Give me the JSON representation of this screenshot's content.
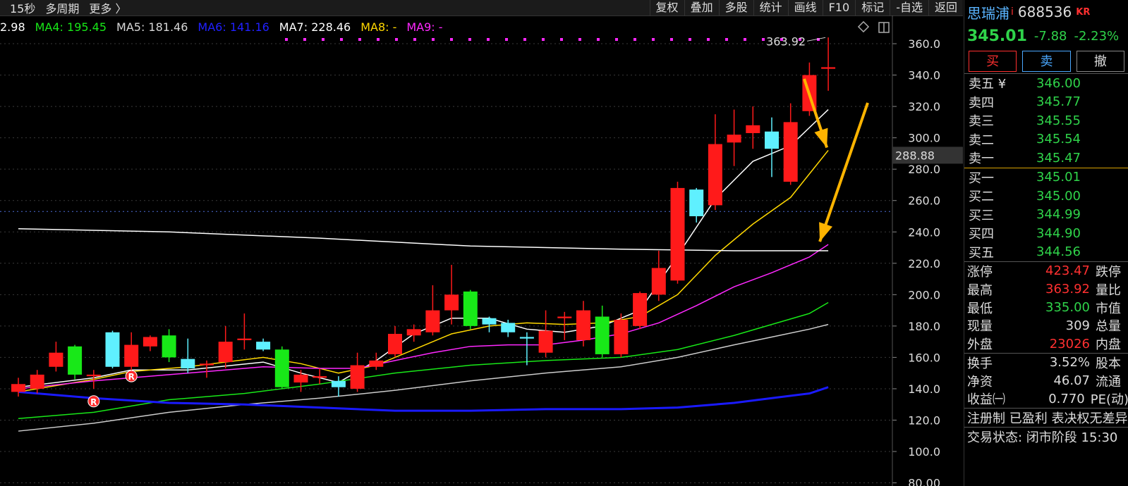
{
  "toolbar": {
    "left": [
      "15秒",
      "多周期",
      "更多 〉"
    ],
    "right": [
      "复权",
      "叠加",
      "多股",
      "统计",
      "画线",
      "F10",
      "标记",
      "-自选",
      "返回"
    ]
  },
  "ma_legend": [
    {
      "label": "2.98",
      "color": "#ffffff"
    },
    {
      "label": "MA4: 195.45",
      "color": "#18e818"
    },
    {
      "label": "MA5: 181.46",
      "color": "#d8d8d8"
    },
    {
      "label": "MA6: 141.16",
      "color": "#2020ff"
    },
    {
      "label": "MA7: 228.46",
      "color": "#ffffff"
    },
    {
      "label": "MA8: -",
      "color": "#ffd800"
    },
    {
      "label": "MA9: -",
      "color": "#ff28ff"
    }
  ],
  "chart_data": {
    "type": "candlestick",
    "y_axis_labels": [
      "360.0",
      "340.0",
      "320.0",
      "300.0",
      "280.0",
      "260.0",
      "240.0",
      "220.0",
      "200.0",
      "180.0",
      "160.0",
      "140.0",
      "120.0",
      "100.0",
      "80.00"
    ],
    "y_ticks": [
      360,
      340,
      320,
      300,
      280,
      260,
      240,
      220,
      200,
      180,
      160,
      140,
      120,
      100,
      80
    ],
    "ylim": [
      78,
      369
    ],
    "high_label": "363.92",
    "current_price_label": "288.88",
    "current_price": 288.88,
    "reference_line": 253,
    "colors": {
      "up": "#ff1a1a",
      "down_green": "#18e818",
      "down_cyan": "#5ff0ff",
      "arrow": "#ffb400",
      "grid": "#3a3a3a"
    },
    "candles": [
      {
        "i": 0,
        "o": 138,
        "c": 143,
        "h": 147,
        "l": 135,
        "col": "red"
      },
      {
        "i": 1,
        "o": 140,
        "c": 149,
        "h": 152,
        "l": 137,
        "col": "red"
      },
      {
        "i": 2,
        "o": 154,
        "c": 163,
        "h": 170,
        "l": 151,
        "col": "red"
      },
      {
        "i": 3,
        "o": 167,
        "c": 149,
        "h": 168,
        "l": 146,
        "col": "green"
      },
      {
        "i": 4,
        "o": 149,
        "c": 148,
        "h": 152,
        "l": 140,
        "col": "red"
      },
      {
        "i": 5,
        "o": 176,
        "c": 154,
        "h": 177,
        "l": 153,
        "col": "cyan"
      },
      {
        "i": 6,
        "o": 154,
        "c": 168,
        "h": 176,
        "l": 150,
        "col": "red"
      },
      {
        "i": 7,
        "o": 167,
        "c": 173,
        "h": 174,
        "l": 164,
        "col": "red"
      },
      {
        "i": 8,
        "o": 174,
        "c": 160,
        "h": 178,
        "l": 157,
        "col": "green"
      },
      {
        "i": 9,
        "o": 159,
        "c": 153,
        "h": 172,
        "l": 150,
        "col": "cyan"
      },
      {
        "i": 10,
        "o": 155,
        "c": 156,
        "h": 158,
        "l": 147,
        "col": "red"
      },
      {
        "i": 11,
        "o": 157,
        "c": 170,
        "h": 180,
        "l": 153,
        "col": "red"
      },
      {
        "i": 12,
        "o": 171,
        "c": 172,
        "h": 188,
        "l": 165,
        "col": "red"
      },
      {
        "i": 13,
        "o": 170,
        "c": 165,
        "h": 172,
        "l": 164,
        "col": "cyan"
      },
      {
        "i": 14,
        "o": 165,
        "c": 141,
        "h": 167,
        "l": 140,
        "col": "green"
      },
      {
        "i": 15,
        "o": 144,
        "c": 149,
        "h": 152,
        "l": 138,
        "col": "red"
      },
      {
        "i": 16,
        "o": 148,
        "c": 147,
        "h": 153,
        "l": 143,
        "col": "red"
      },
      {
        "i": 17,
        "o": 145,
        "c": 141,
        "h": 148,
        "l": 135,
        "col": "cyan"
      },
      {
        "i": 18,
        "o": 140,
        "c": 155,
        "h": 163,
        "l": 138,
        "col": "red"
      },
      {
        "i": 19,
        "o": 154,
        "c": 158,
        "h": 163,
        "l": 152,
        "col": "red"
      },
      {
        "i": 20,
        "o": 162,
        "c": 175,
        "h": 180,
        "l": 160,
        "col": "red"
      },
      {
        "i": 21,
        "o": 174,
        "c": 178,
        "h": 181,
        "l": 170,
        "col": "red"
      },
      {
        "i": 22,
        "o": 176,
        "c": 190,
        "h": 206,
        "l": 174,
        "col": "red"
      },
      {
        "i": 23,
        "o": 190,
        "c": 200,
        "h": 219,
        "l": 181,
        "col": "red"
      },
      {
        "i": 24,
        "o": 202,
        "c": 180,
        "h": 203,
        "l": 178,
        "col": "green"
      },
      {
        "i": 25,
        "o": 185,
        "c": 181,
        "h": 186,
        "l": 176,
        "col": "cyan"
      },
      {
        "i": 26,
        "o": 182,
        "c": 176,
        "h": 184,
        "l": 173,
        "col": "cyan"
      },
      {
        "i": 27,
        "o": 173,
        "c": 172,
        "h": 176,
        "l": 155,
        "col": "cyan"
      },
      {
        "i": 28,
        "o": 163,
        "c": 177,
        "h": 190,
        "l": 160,
        "col": "red"
      },
      {
        "i": 29,
        "o": 185,
        "c": 186,
        "h": 189,
        "l": 171,
        "col": "red"
      },
      {
        "i": 30,
        "o": 171,
        "c": 190,
        "h": 196,
        "l": 167,
        "col": "red"
      },
      {
        "i": 31,
        "o": 186,
        "c": 162,
        "h": 193,
        "l": 160,
        "col": "green"
      },
      {
        "i": 32,
        "o": 162,
        "c": 184,
        "h": 188,
        "l": 160,
        "col": "red"
      },
      {
        "i": 33,
        "o": 180,
        "c": 201,
        "h": 202,
        "l": 178,
        "col": "red"
      },
      {
        "i": 34,
        "o": 200,
        "c": 217,
        "h": 228,
        "l": 196,
        "col": "red"
      },
      {
        "i": 35,
        "o": 209,
        "c": 268,
        "h": 272,
        "l": 207,
        "col": "red"
      },
      {
        "i": 36,
        "o": 267,
        "c": 250,
        "h": 268,
        "l": 246,
        "col": "cyan"
      },
      {
        "i": 37,
        "o": 257,
        "c": 296,
        "h": 315,
        "l": 254,
        "col": "red"
      },
      {
        "i": 38,
        "o": 297,
        "c": 302,
        "h": 318,
        "l": 282,
        "col": "red"
      },
      {
        "i": 39,
        "o": 303,
        "c": 308,
        "h": 320,
        "l": 293,
        "col": "red"
      },
      {
        "i": 40,
        "o": 304,
        "c": 293,
        "h": 313,
        "l": 275,
        "col": "cyan"
      },
      {
        "i": 41,
        "o": 272,
        "c": 310,
        "h": 322,
        "l": 270,
        "col": "red"
      },
      {
        "i": 42,
        "o": 317,
        "c": 340,
        "h": 348,
        "l": 314,
        "col": "red"
      },
      {
        "i": 43,
        "o": 344,
        "c": 345,
        "h": 364,
        "l": 330,
        "col": "red"
      }
    ],
    "ma_lines": [
      {
        "color": "#ffffff",
        "pts": [
          [
            0,
            141
          ],
          [
            4,
            147
          ],
          [
            6,
            152
          ],
          [
            9,
            152
          ],
          [
            13,
            157
          ],
          [
            15,
            150
          ],
          [
            17,
            144
          ],
          [
            19,
            158
          ],
          [
            21,
            175
          ],
          [
            23,
            185
          ],
          [
            25,
            185
          ],
          [
            27,
            178
          ],
          [
            29,
            176
          ],
          [
            31,
            180
          ],
          [
            33,
            190
          ],
          [
            35,
            225
          ],
          [
            37,
            261
          ],
          [
            39,
            285
          ],
          [
            41,
            295
          ],
          [
            43,
            318
          ]
        ]
      },
      {
        "color": "#ffd800",
        "pts": [
          [
            0,
            138
          ],
          [
            4,
            146
          ],
          [
            6,
            151
          ],
          [
            9,
            154
          ],
          [
            13,
            160
          ],
          [
            15,
            156
          ],
          [
            17,
            150
          ],
          [
            19,
            155
          ],
          [
            21,
            165
          ],
          [
            23,
            175
          ],
          [
            25,
            180
          ],
          [
            27,
            182
          ],
          [
            29,
            181
          ],
          [
            31,
            182
          ],
          [
            33,
            186
          ],
          [
            35,
            200
          ],
          [
            37,
            225
          ],
          [
            39,
            245
          ],
          [
            41,
            262
          ],
          [
            43,
            292
          ]
        ]
      },
      {
        "color": "#ff28ff",
        "pts": [
          [
            0,
            140
          ],
          [
            4,
            145
          ],
          [
            7,
            148
          ],
          [
            10,
            151
          ],
          [
            13,
            154
          ],
          [
            16,
            153
          ],
          [
            18,
            153
          ],
          [
            20,
            158
          ],
          [
            22,
            163
          ],
          [
            24,
            167
          ],
          [
            26,
            168
          ],
          [
            28,
            168
          ],
          [
            30,
            171
          ],
          [
            32,
            175
          ],
          [
            34,
            182
          ],
          [
            36,
            193
          ],
          [
            38,
            205
          ],
          [
            40,
            214
          ],
          [
            42,
            224
          ],
          [
            43,
            232
          ]
        ]
      },
      {
        "color": "#18e818",
        "pts": [
          [
            0,
            121
          ],
          [
            4,
            125
          ],
          [
            8,
            133
          ],
          [
            12,
            137
          ],
          [
            16,
            143
          ],
          [
            20,
            150
          ],
          [
            24,
            155
          ],
          [
            28,
            158
          ],
          [
            32,
            160
          ],
          [
            35,
            165
          ],
          [
            38,
            174
          ],
          [
            40,
            181
          ],
          [
            42,
            188
          ],
          [
            43,
            195
          ]
        ]
      },
      {
        "color": "#cccccc",
        "pts": [
          [
            0,
            113
          ],
          [
            4,
            118
          ],
          [
            8,
            125
          ],
          [
            12,
            130
          ],
          [
            16,
            134
          ],
          [
            20,
            139
          ],
          [
            24,
            145
          ],
          [
            28,
            150
          ],
          [
            32,
            154
          ],
          [
            35,
            160
          ],
          [
            38,
            168
          ],
          [
            40,
            173
          ],
          [
            42,
            178
          ],
          [
            43,
            181
          ]
        ]
      },
      {
        "color": "#1a1aff",
        "pts": [
          [
            0,
            138
          ],
          [
            4,
            134
          ],
          [
            8,
            131
          ],
          [
            12,
            130
          ],
          [
            16,
            128
          ],
          [
            20,
            126
          ],
          [
            24,
            126
          ],
          [
            28,
            127
          ],
          [
            32,
            127
          ],
          [
            35,
            128
          ],
          [
            38,
            131
          ],
          [
            40,
            134
          ],
          [
            42,
            137
          ],
          [
            43,
            141
          ]
        ]
      },
      {
        "color": "#ffffff",
        "pts": [
          [
            0,
            242
          ],
          [
            8,
            240
          ],
          [
            16,
            236
          ],
          [
            24,
            231
          ],
          [
            32,
            229
          ],
          [
            38,
            228
          ],
          [
            43,
            228
          ]
        ]
      }
    ]
  },
  "stock": {
    "name": "思瑞浦",
    "tag": "i",
    "code": "688536",
    "suffix": "KR",
    "price": "345.01",
    "change": "-7.88",
    "change_pct": "-2.23%"
  },
  "trade_buttons": [
    {
      "label": "买",
      "color": "#ff3030"
    },
    {
      "label": "卖",
      "color": "#4aa8ff"
    },
    {
      "label": "撤",
      "color": "#dddddd"
    }
  ],
  "order_book": {
    "asks": [
      {
        "label": "卖五 ¥",
        "price": "346.00"
      },
      {
        "label": "卖四",
        "price": "345.77"
      },
      {
        "label": "卖三",
        "price": "345.55"
      },
      {
        "label": "卖二",
        "price": "345.54"
      },
      {
        "label": "卖一",
        "price": "345.47"
      }
    ],
    "bids": [
      {
        "label": "买一",
        "price": "345.01"
      },
      {
        "label": "买二",
        "price": "345.00"
      },
      {
        "label": "买三",
        "price": "344.99"
      },
      {
        "label": "买四",
        "price": "344.90"
      },
      {
        "label": "买五",
        "price": "344.56"
      }
    ]
  },
  "stats_a": [
    {
      "label": "涨停",
      "value": "423.47",
      "color": "#ff3030",
      "label2": "跌停"
    },
    {
      "label": "最高",
      "value": "363.92",
      "color": "#ff3030",
      "label2": "量比"
    },
    {
      "label": "最低",
      "value": "335.00",
      "color": "#2fd34a",
      "label2": "市值"
    },
    {
      "label": "现量",
      "value": "309",
      "color": "#dddddd",
      "label2": "总量"
    },
    {
      "label": "外盘",
      "value": "23026",
      "color": "#ff3030",
      "label2": "内盘"
    }
  ],
  "stats_b": [
    {
      "label": "换手",
      "value": "3.52%",
      "color": "#dddddd",
      "label2": "股本"
    },
    {
      "label": "净资",
      "value": "46.07",
      "color": "#dddddd",
      "label2": "流通"
    },
    {
      "label": "收益㈠",
      "value": "0.770",
      "color": "#dddddd",
      "label2": "PE(动)"
    }
  ],
  "footer": {
    "tags": "注册制 已盈利 表决权无差异",
    "status": "交易状态: 闭市阶段 15:30"
  },
  "markers": [
    {
      "label": "R",
      "i": 4,
      "v": 132
    },
    {
      "label": "R",
      "i": 6,
      "v": 148
    }
  ]
}
